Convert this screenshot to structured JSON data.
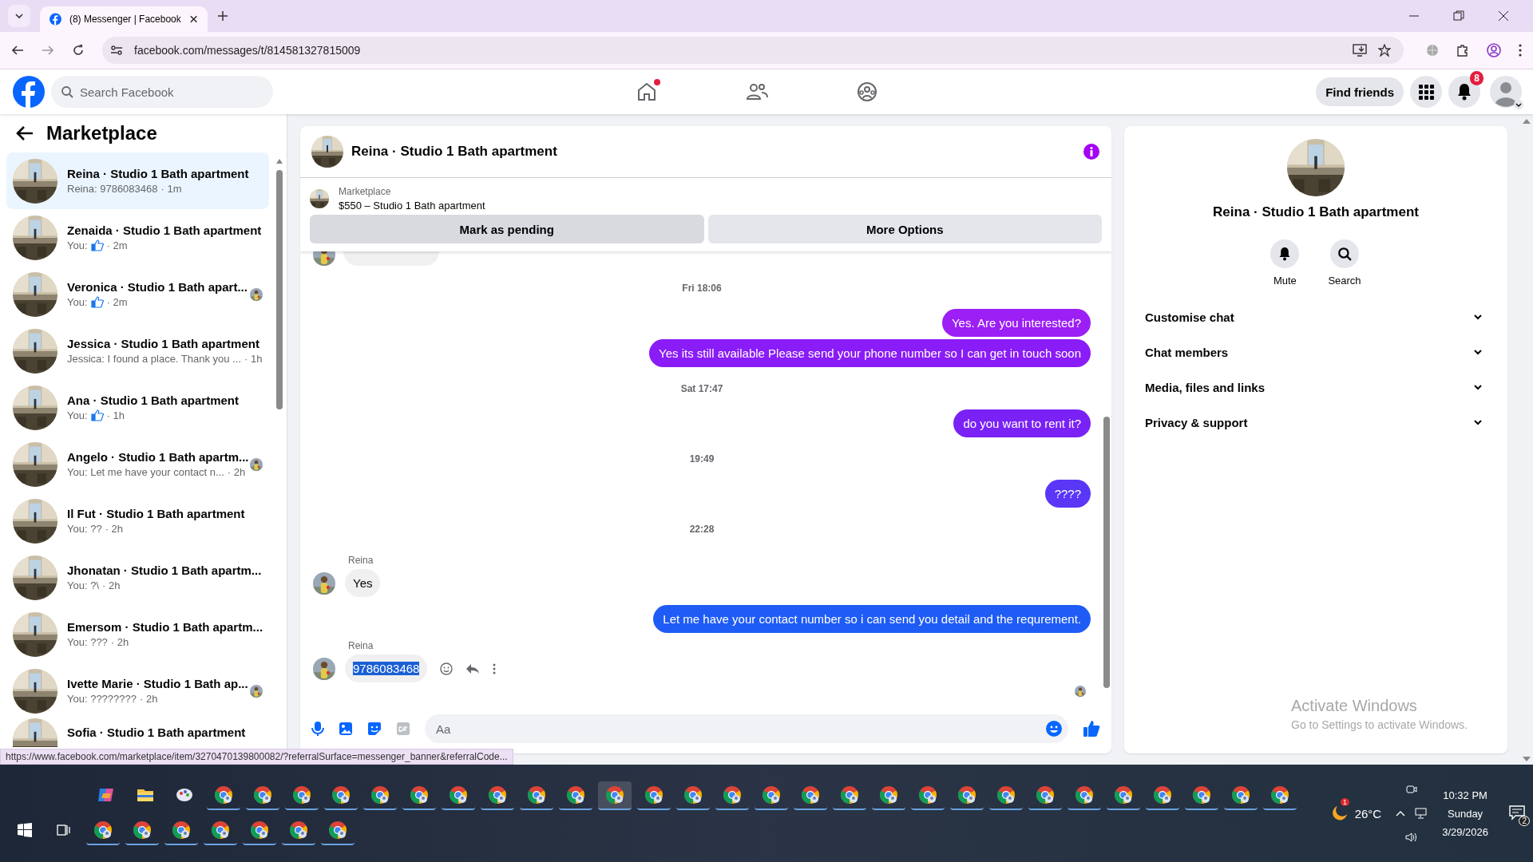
{
  "browser": {
    "tab_title": "(8) Messenger | Facebook",
    "url": "facebook.com/messages/t/814581327815009"
  },
  "header": {
    "search": {
      "placeholder": "Search Facebook"
    },
    "nav": [
      {
        "kind": "home",
        "dot": true
      },
      {
        "kind": "friends",
        "dot": false
      },
      {
        "kind": "groups",
        "dot": false
      }
    ],
    "find_friends": "Find friends",
    "notification_count": "8"
  },
  "sidebar": {
    "title": "Marketplace",
    "chats": [
      {
        "name": "Reina · Studio 1 Bath apartment",
        "preview": "Reina: 9786083468",
        "like": false,
        "time": "· 1m",
        "seen": false,
        "selected": true
      },
      {
        "name": "Zenaida · Studio 1 Bath apartment",
        "preview": "You:",
        "like": true,
        "time": "· 2m",
        "seen": false,
        "selected": false
      },
      {
        "name": "Veronica · Studio 1 Bath apart...",
        "preview": "You:",
        "like": true,
        "time": "· 2m",
        "seen": true,
        "selected": false
      },
      {
        "name": "Jessica · Studio 1 Bath apartment",
        "preview": "Jessica: I found a place. Thank you ...",
        "like": false,
        "time": "· 1h",
        "seen": false,
        "selected": false
      },
      {
        "name": "Ana · Studio 1 Bath apartment",
        "preview": "You:",
        "like": true,
        "time": "· 1h",
        "seen": false,
        "selected": false
      },
      {
        "name": "Angelo · Studio 1 Bath apartm...",
        "preview": "You: Let me have your contact n...",
        "like": false,
        "time": "· 2h",
        "seen": true,
        "selected": false
      },
      {
        "name": "Il Fut · Studio 1 Bath apartment",
        "preview": "You: ??",
        "like": false,
        "time": "· 2h",
        "seen": false,
        "selected": false
      },
      {
        "name": "Jhonatan · Studio 1 Bath apartm...",
        "preview": "You: ?\\",
        "like": false,
        "time": "· 2h",
        "seen": false,
        "selected": false
      },
      {
        "name": "Emersom · Studio 1 Bath apartm...",
        "preview": "You: ???",
        "like": false,
        "time": "· 2h",
        "seen": false,
        "selected": false
      },
      {
        "name": "Ivette Marie · Studio 1 Bath ap...",
        "preview": "You: ????????",
        "like": false,
        "time": "· 2h",
        "seen": true,
        "selected": false
      },
      {
        "name": "Sofia · Studio 1 Bath apartment",
        "like": false,
        "seen": false,
        "selected": false
      }
    ]
  },
  "chat": {
    "title": "Reina · Studio 1 Bath apartment",
    "listing": {
      "label": "Marketplace",
      "title": "$550 – Studio 1 Bath apartment"
    },
    "buttons": [
      "Mark as pending",
      "More Options"
    ],
    "messages": [
      {
        "kind": "clipped"
      },
      {
        "kind": "time",
        "text": "Fri 18:06"
      },
      {
        "kind": "out",
        "text": "Yes. Are you interested?",
        "color": "#9c1ff5"
      },
      {
        "kind": "out",
        "text": "Yes its still available Please send your phone number so I can get in touch soon",
        "color": "#8a1cf7"
      },
      {
        "kind": "time",
        "text": "Sat 17:47"
      },
      {
        "kind": "out",
        "text": "do you want to rent it?",
        "color": "#7a22f5"
      },
      {
        "kind": "time",
        "text": "19:49"
      },
      {
        "kind": "out",
        "text": "????",
        "color": "#5a36f6"
      },
      {
        "kind": "time",
        "text": "22:28"
      },
      {
        "kind": "in",
        "sender": "Reina",
        "text": "Yes",
        "highlighted": false
      },
      {
        "kind": "out",
        "text": "Let me have your contact number so i can send you detail and the requrement.",
        "color": "#1f5cf6"
      },
      {
        "kind": "in",
        "sender": "Reina",
        "text": "9786083468",
        "highlighted": true
      }
    ],
    "composer": {
      "placeholder": "Aa"
    }
  },
  "details": {
    "title": "Reina · Studio 1 Bath apartment",
    "actions": [
      {
        "kind": "mute",
        "label": "Mute"
      },
      {
        "kind": "search",
        "label": "Search"
      }
    ],
    "sections": [
      "Customise chat",
      "Chat members",
      "Media, files and links",
      "Privacy & support"
    ]
  },
  "status_url": "https://www.facebook.com/marketplace/item/3270470139800082/?referralSurface=messenger_banner&referralCode...",
  "activation": {
    "title": "Activate Windows",
    "subtitle": "Go to Settings to activate Windows."
  },
  "taskbar": {
    "time": "10:32 PM",
    "day": "Sunday",
    "date": "3/29/2026",
    "temperature": "26°C",
    "weather_badge": "1",
    "notification_badge": "2"
  }
}
